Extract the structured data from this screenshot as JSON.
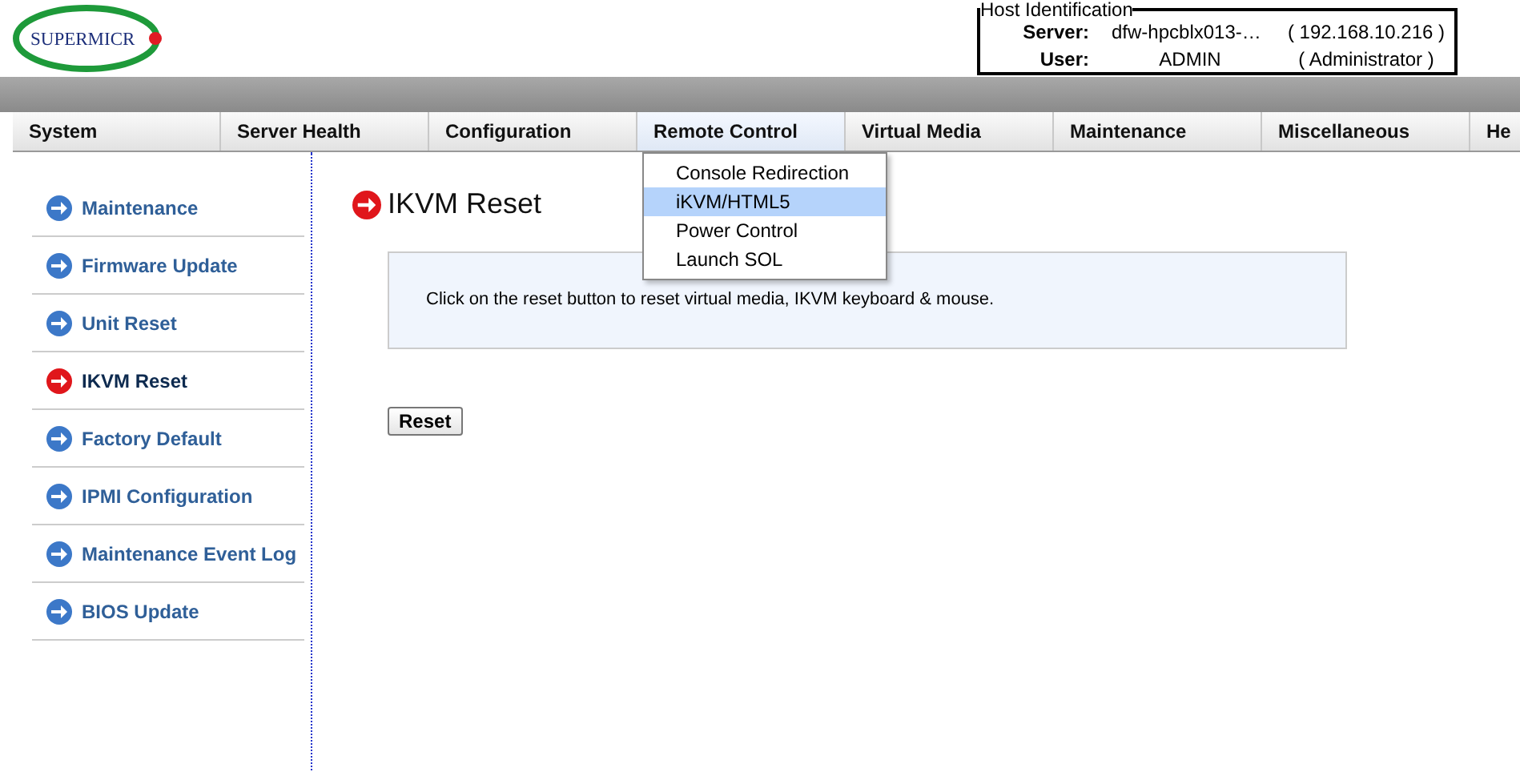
{
  "logo": {
    "text": "SUPERMICR"
  },
  "host_identification": {
    "legend": "Host Identification",
    "rows": [
      {
        "label": "Server:",
        "value": "dfw-hpcblx013-…",
        "detail": "( 192.168.10.216 )"
      },
      {
        "label": "User:",
        "value": "ADMIN",
        "detail": "( Administrator )"
      }
    ]
  },
  "nav": [
    {
      "label": "System",
      "selected": false
    },
    {
      "label": "Server Health",
      "selected": false
    },
    {
      "label": "Configuration",
      "selected": false
    },
    {
      "label": "Remote Control",
      "selected": true
    },
    {
      "label": "Virtual Media",
      "selected": false
    },
    {
      "label": "Maintenance",
      "selected": false
    },
    {
      "label": "Miscellaneous",
      "selected": false
    },
    {
      "label": "He",
      "selected": false
    }
  ],
  "dropdown": [
    {
      "label": "Console Redirection",
      "selected": false
    },
    {
      "label": "iKVM/HTML5",
      "selected": true
    },
    {
      "label": "Power Control",
      "selected": false
    },
    {
      "label": "Launch SOL",
      "selected": false
    }
  ],
  "sidebar": [
    {
      "label": "Maintenance",
      "selected": false
    },
    {
      "label": "Firmware Update",
      "selected": false
    },
    {
      "label": "Unit Reset",
      "selected": false
    },
    {
      "label": "IKVM Reset",
      "selected": true
    },
    {
      "label": "Factory Default",
      "selected": false
    },
    {
      "label": "IPMI Configuration",
      "selected": false
    },
    {
      "label": "Maintenance Event Log",
      "selected": false
    },
    {
      "label": "BIOS Update",
      "selected": false
    }
  ],
  "page": {
    "title": "IKVM Reset",
    "info": "Click on the reset button to reset virtual media, IKVM keyboard & mouse.",
    "button": "Reset"
  }
}
